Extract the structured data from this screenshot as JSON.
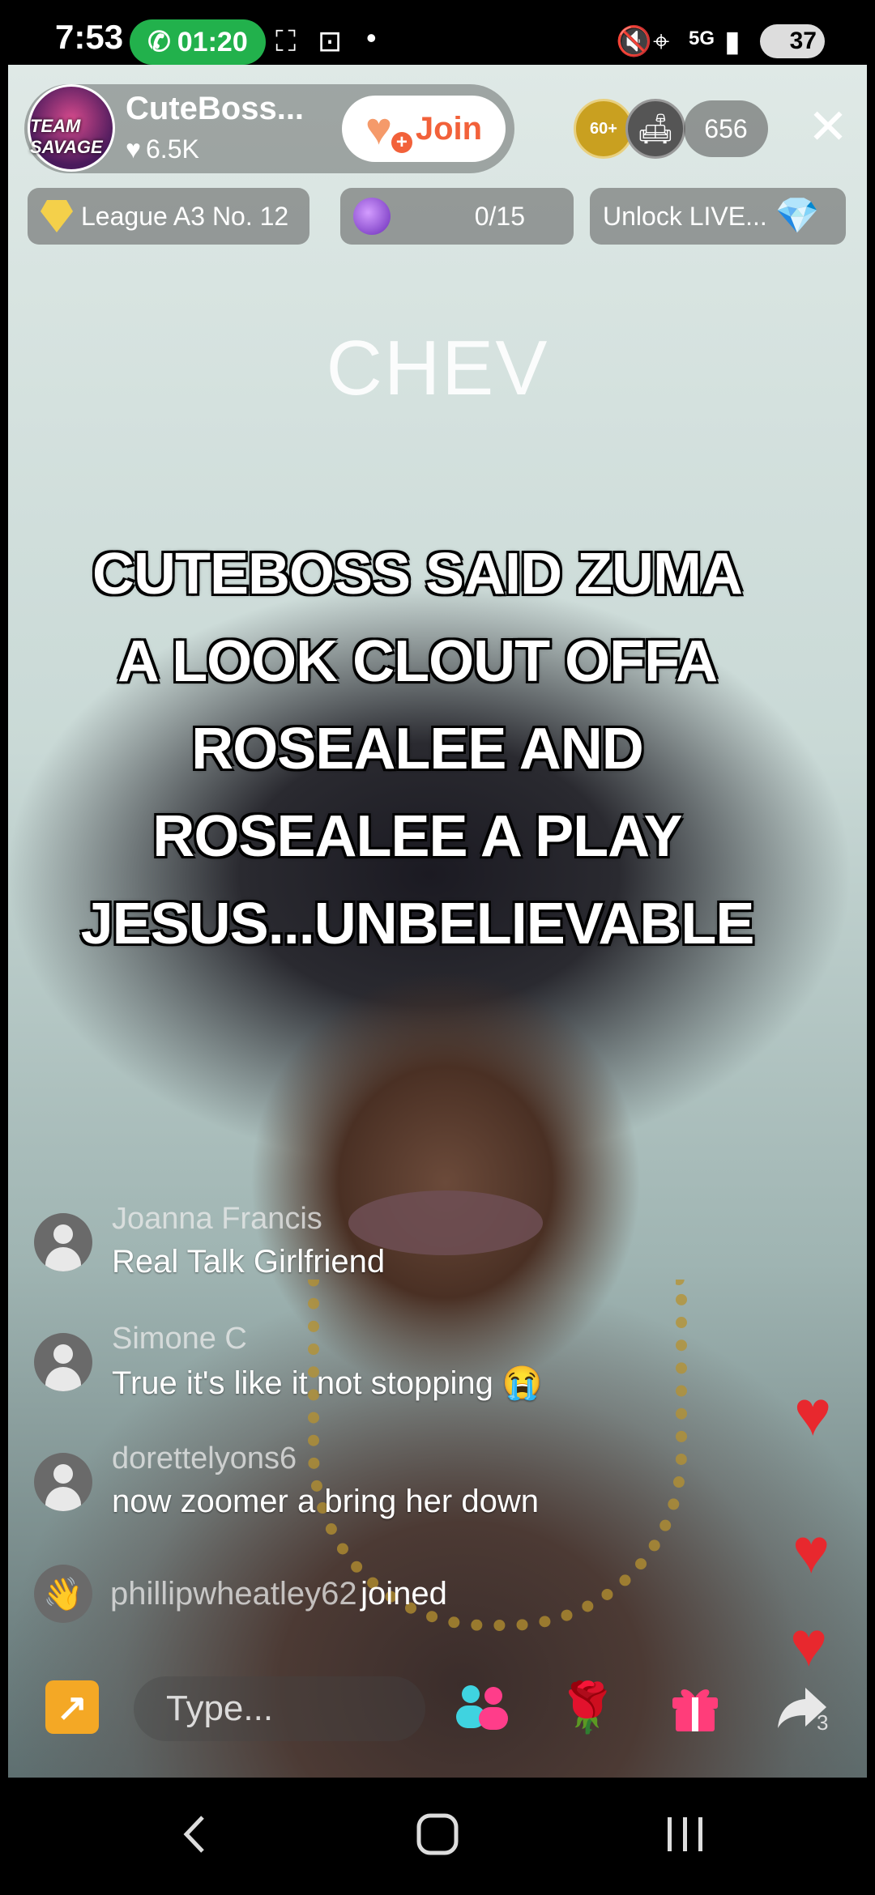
{
  "status_bar": {
    "time": "7:53",
    "call_timer": "01:20",
    "battery": "37",
    "icons": [
      "phone-call-icon",
      "screen-record-icon",
      "screenshot-icon",
      "dot-icon",
      "mute-icon",
      "location-icon",
      "5g-icon",
      "signal-icon",
      "battery-icon"
    ]
  },
  "header": {
    "host_name": "CuteBoss...",
    "host_likes": "6.5K",
    "avatar_text": "TEAM SAVAGE",
    "join_label": "Join",
    "viewer_badge": "60+",
    "viewer_count": "656"
  },
  "chips": {
    "league": "League A3 No. 12",
    "goal": "0/15",
    "unlock": "Unlock LIVE..."
  },
  "overlay": {
    "watermark": "CHEV",
    "caption_lines": [
      "CUTEBOSS SAID ZUMA",
      "A LOOK CLOUT OFFA",
      "ROSEALEE AND",
      "ROSEALEE A PLAY",
      "JESUS...UNBELIEVABLE"
    ]
  },
  "comments": [
    {
      "user": "Joanna Francis",
      "text": "Real Talk Girlfriend"
    },
    {
      "user": "Simone C",
      "text": "True it's like it not stopping 😭"
    },
    {
      "user": "dorettelyons6",
      "text": "now zoomer a bring her down"
    }
  ],
  "join_event": {
    "user": "phillipwheatley62",
    "verb": "joined"
  },
  "bottom_bar": {
    "type_placeholder": "Type...",
    "share_count": "3"
  },
  "colors": {
    "join_text": "#f2613a",
    "call_pill": "#22b14c",
    "heart": "#e8282e",
    "share_live": "#f4a825"
  }
}
